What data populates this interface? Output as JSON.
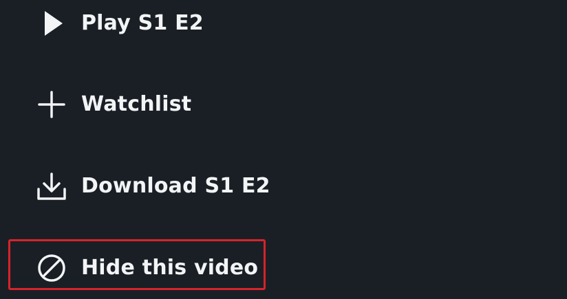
{
  "menu": {
    "items": [
      {
        "id": "play",
        "label": "Play S1 E2",
        "icon": "play-icon"
      },
      {
        "id": "watchlist",
        "label": "Watchlist",
        "icon": "plus-icon"
      },
      {
        "id": "download",
        "label": "Download S1 E2",
        "icon": "download-icon"
      },
      {
        "id": "hide",
        "label": "Hide this video",
        "icon": "hide-icon"
      }
    ]
  },
  "colors": {
    "background": "#1a1f26",
    "text": "#f2f4f5",
    "highlight": "#d8232a"
  }
}
